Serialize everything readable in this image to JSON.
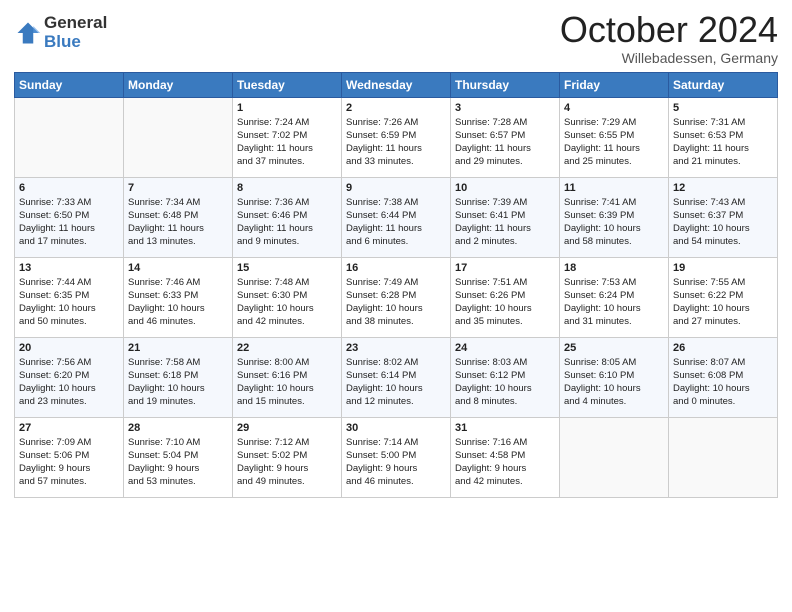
{
  "logo": {
    "general": "General",
    "blue": "Blue"
  },
  "header": {
    "month": "October 2024",
    "location": "Willebadessen, Germany"
  },
  "weekdays": [
    "Sunday",
    "Monday",
    "Tuesday",
    "Wednesday",
    "Thursday",
    "Friday",
    "Saturday"
  ],
  "weeks": [
    [
      {
        "day": "",
        "info": ""
      },
      {
        "day": "",
        "info": ""
      },
      {
        "day": "1",
        "info": "Sunrise: 7:24 AM\nSunset: 7:02 PM\nDaylight: 11 hours\nand 37 minutes."
      },
      {
        "day": "2",
        "info": "Sunrise: 7:26 AM\nSunset: 6:59 PM\nDaylight: 11 hours\nand 33 minutes."
      },
      {
        "day": "3",
        "info": "Sunrise: 7:28 AM\nSunset: 6:57 PM\nDaylight: 11 hours\nand 29 minutes."
      },
      {
        "day": "4",
        "info": "Sunrise: 7:29 AM\nSunset: 6:55 PM\nDaylight: 11 hours\nand 25 minutes."
      },
      {
        "day": "5",
        "info": "Sunrise: 7:31 AM\nSunset: 6:53 PM\nDaylight: 11 hours\nand 21 minutes."
      }
    ],
    [
      {
        "day": "6",
        "info": "Sunrise: 7:33 AM\nSunset: 6:50 PM\nDaylight: 11 hours\nand 17 minutes."
      },
      {
        "day": "7",
        "info": "Sunrise: 7:34 AM\nSunset: 6:48 PM\nDaylight: 11 hours\nand 13 minutes."
      },
      {
        "day": "8",
        "info": "Sunrise: 7:36 AM\nSunset: 6:46 PM\nDaylight: 11 hours\nand 9 minutes."
      },
      {
        "day": "9",
        "info": "Sunrise: 7:38 AM\nSunset: 6:44 PM\nDaylight: 11 hours\nand 6 minutes."
      },
      {
        "day": "10",
        "info": "Sunrise: 7:39 AM\nSunset: 6:41 PM\nDaylight: 11 hours\nand 2 minutes."
      },
      {
        "day": "11",
        "info": "Sunrise: 7:41 AM\nSunset: 6:39 PM\nDaylight: 10 hours\nand 58 minutes."
      },
      {
        "day": "12",
        "info": "Sunrise: 7:43 AM\nSunset: 6:37 PM\nDaylight: 10 hours\nand 54 minutes."
      }
    ],
    [
      {
        "day": "13",
        "info": "Sunrise: 7:44 AM\nSunset: 6:35 PM\nDaylight: 10 hours\nand 50 minutes."
      },
      {
        "day": "14",
        "info": "Sunrise: 7:46 AM\nSunset: 6:33 PM\nDaylight: 10 hours\nand 46 minutes."
      },
      {
        "day": "15",
        "info": "Sunrise: 7:48 AM\nSunset: 6:30 PM\nDaylight: 10 hours\nand 42 minutes."
      },
      {
        "day": "16",
        "info": "Sunrise: 7:49 AM\nSunset: 6:28 PM\nDaylight: 10 hours\nand 38 minutes."
      },
      {
        "day": "17",
        "info": "Sunrise: 7:51 AM\nSunset: 6:26 PM\nDaylight: 10 hours\nand 35 minutes."
      },
      {
        "day": "18",
        "info": "Sunrise: 7:53 AM\nSunset: 6:24 PM\nDaylight: 10 hours\nand 31 minutes."
      },
      {
        "day": "19",
        "info": "Sunrise: 7:55 AM\nSunset: 6:22 PM\nDaylight: 10 hours\nand 27 minutes."
      }
    ],
    [
      {
        "day": "20",
        "info": "Sunrise: 7:56 AM\nSunset: 6:20 PM\nDaylight: 10 hours\nand 23 minutes."
      },
      {
        "day": "21",
        "info": "Sunrise: 7:58 AM\nSunset: 6:18 PM\nDaylight: 10 hours\nand 19 minutes."
      },
      {
        "day": "22",
        "info": "Sunrise: 8:00 AM\nSunset: 6:16 PM\nDaylight: 10 hours\nand 15 minutes."
      },
      {
        "day": "23",
        "info": "Sunrise: 8:02 AM\nSunset: 6:14 PM\nDaylight: 10 hours\nand 12 minutes."
      },
      {
        "day": "24",
        "info": "Sunrise: 8:03 AM\nSunset: 6:12 PM\nDaylight: 10 hours\nand 8 minutes."
      },
      {
        "day": "25",
        "info": "Sunrise: 8:05 AM\nSunset: 6:10 PM\nDaylight: 10 hours\nand 4 minutes."
      },
      {
        "day": "26",
        "info": "Sunrise: 8:07 AM\nSunset: 6:08 PM\nDaylight: 10 hours\nand 0 minutes."
      }
    ],
    [
      {
        "day": "27",
        "info": "Sunrise: 7:09 AM\nSunset: 5:06 PM\nDaylight: 9 hours\nand 57 minutes."
      },
      {
        "day": "28",
        "info": "Sunrise: 7:10 AM\nSunset: 5:04 PM\nDaylight: 9 hours\nand 53 minutes."
      },
      {
        "day": "29",
        "info": "Sunrise: 7:12 AM\nSunset: 5:02 PM\nDaylight: 9 hours\nand 49 minutes."
      },
      {
        "day": "30",
        "info": "Sunrise: 7:14 AM\nSunset: 5:00 PM\nDaylight: 9 hours\nand 46 minutes."
      },
      {
        "day": "31",
        "info": "Sunrise: 7:16 AM\nSunset: 4:58 PM\nDaylight: 9 hours\nand 42 minutes."
      },
      {
        "day": "",
        "info": ""
      },
      {
        "day": "",
        "info": ""
      }
    ]
  ]
}
